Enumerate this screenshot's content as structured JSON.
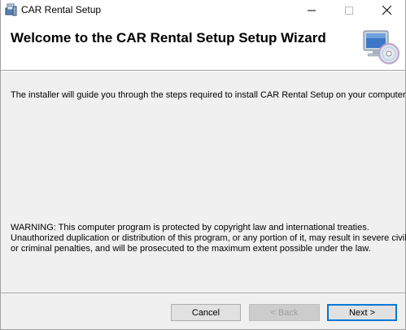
{
  "window": {
    "title": "CAR Rental Setup",
    "controls": {
      "minimize": "—",
      "maximize": "☐",
      "close": "✕"
    }
  },
  "banner": {
    "title": "Welcome to the CAR Rental Setup Setup Wizard",
    "icon": "computer-cd-icon"
  },
  "content": {
    "intro": "The installer will guide you through the steps required to install CAR Rental Setup on your computer.",
    "warning_lines": [
      "WARNING: This computer program is protected by copyright law and international treaties.",
      "Unauthorized duplication or distribution of this program, or any portion of it, may result in severe civil",
      "or criminal penalties, and will be prosecuted to the maximum extent possible under the law."
    ]
  },
  "buttons": {
    "cancel": "Cancel",
    "back": "< Back",
    "next": "Next >"
  },
  "colors": {
    "accent": "#0078d7",
    "window_bg": "#f0f0f0",
    "banner_bg": "#ffffff"
  }
}
